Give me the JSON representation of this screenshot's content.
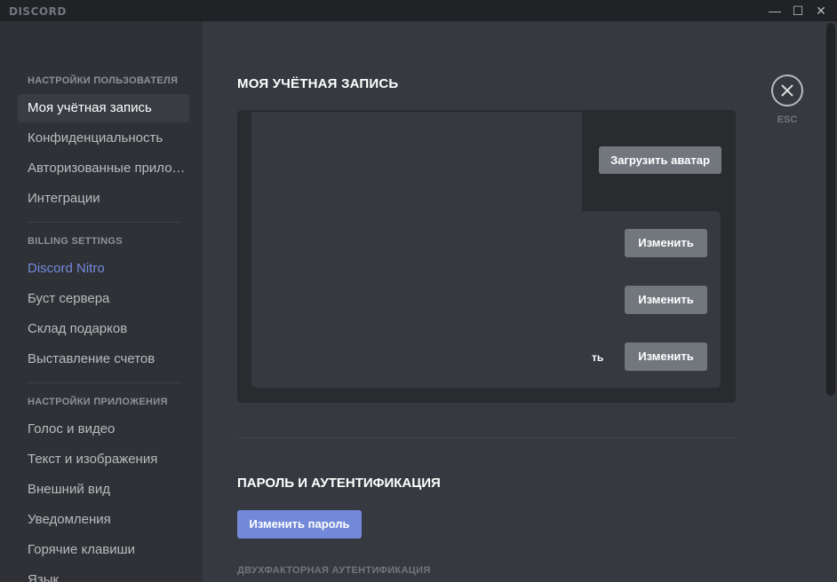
{
  "app": {
    "title": "DISCORD"
  },
  "window_controls": {
    "minimize": "—",
    "maximize": "☐",
    "close": "✕"
  },
  "sidebar": {
    "sections": [
      {
        "header": "Настройки пользователя",
        "items": [
          {
            "label": "Моя учётная запись",
            "active": true
          },
          {
            "label": "Конфиденциальность"
          },
          {
            "label": "Авторизованные приложения"
          },
          {
            "label": "Интеграции"
          }
        ]
      },
      {
        "header": "Billing Settings",
        "items": [
          {
            "label": "Discord Nitro"
          },
          {
            "label": "Буст сервера"
          },
          {
            "label": "Склад подарков"
          },
          {
            "label": "Выставление счетов"
          }
        ]
      },
      {
        "header": "Настройки приложения",
        "items": [
          {
            "label": "Голос и видео"
          },
          {
            "label": "Текст и изображения"
          },
          {
            "label": "Внешний вид"
          },
          {
            "label": "Уведомления"
          },
          {
            "label": "Горячие клавиши"
          },
          {
            "label": "Язык"
          }
        ]
      }
    ]
  },
  "main": {
    "title": "Моя учётная запись",
    "upload_avatar": "Загрузить аватар",
    "edit_label": "Изменить",
    "partial_field": "ть",
    "password_section": {
      "title": "Пароль и аутентификация",
      "change_password": "Изменить пароль",
      "twofa_heading": "Двухфакторная аутентификация"
    }
  },
  "close": {
    "label": "ESC",
    "icon": "close-icon"
  },
  "colors": {
    "accent": "#7289da",
    "button_gray": "#72767d",
    "bg": "#36393f",
    "sidebar_bg": "#2f3136"
  }
}
